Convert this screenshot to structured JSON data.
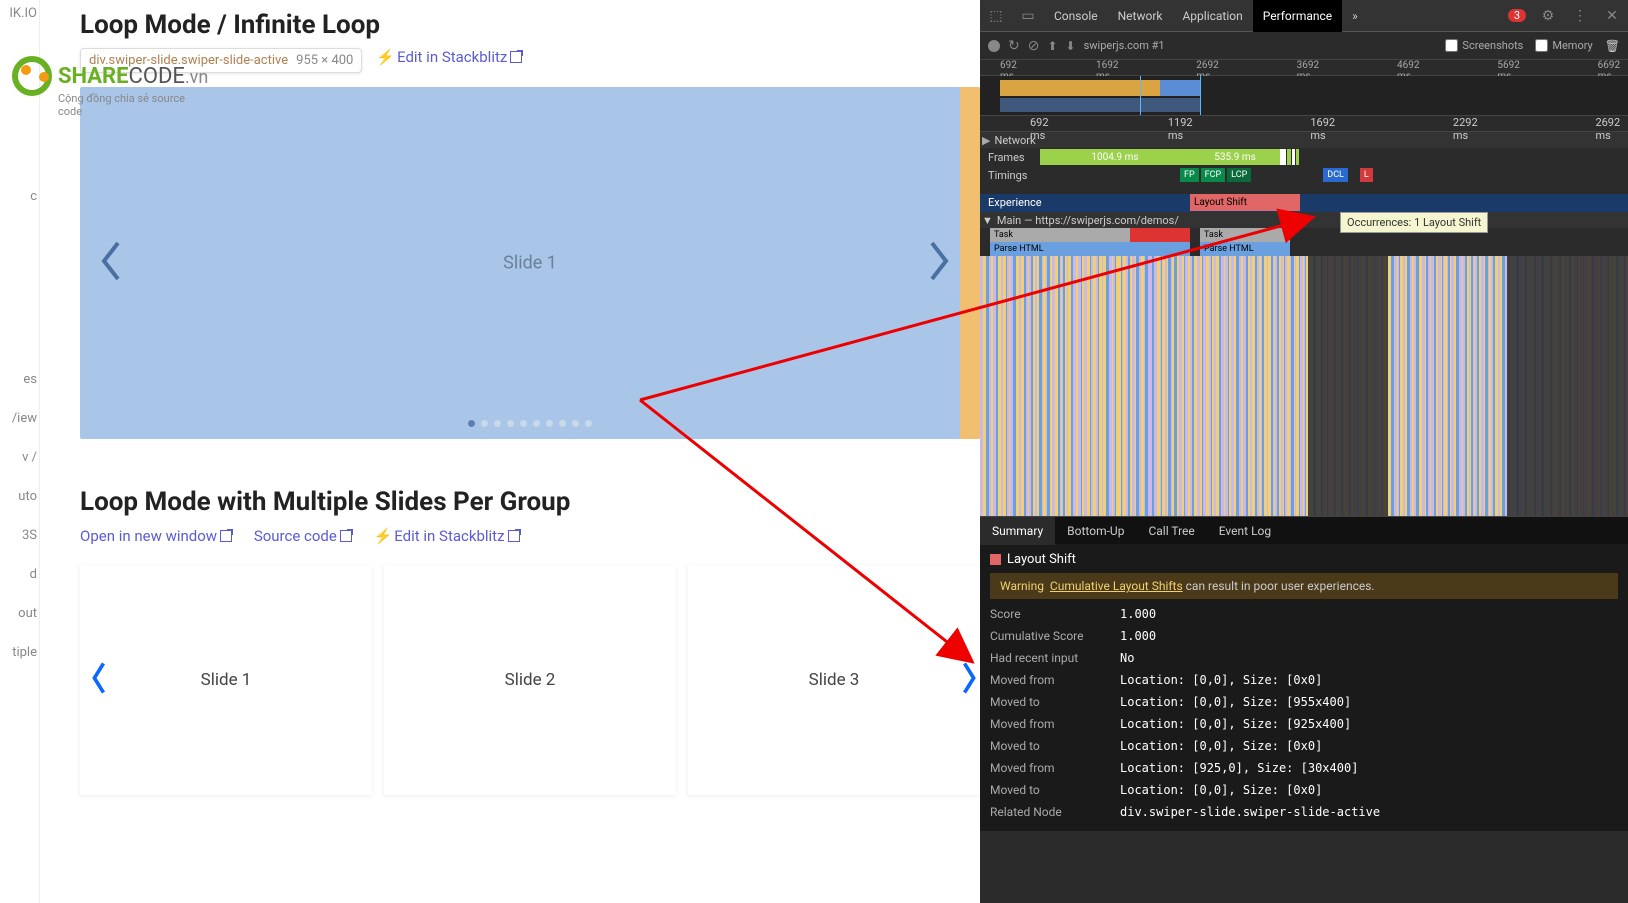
{
  "sidebar": {
    "items": [
      "IK.IO",
      "c",
      "es",
      "/iew",
      "v /",
      "uto",
      "3S",
      "d",
      "out",
      "tiple"
    ]
  },
  "page": {
    "heading1": "Loop Mode / Infinite Loop",
    "inspect_selector": "div.swiper-slide.swiper-slide-active",
    "inspect_dims": "955 × 400",
    "edit_link": "Edit in Stackblitz",
    "swiper1": {
      "slide_label": "Slide 1",
      "dot_count": 10,
      "active_dot": 0
    },
    "heading2": "Loop Mode with Multiple Slides Per Group",
    "links": {
      "open": "Open in new window",
      "source": "Source code",
      "edit": "Edit in Stackblitz"
    },
    "swiper2": {
      "cards": [
        "Slide 1",
        "Slide 2",
        "Slide 3"
      ]
    }
  },
  "logo": {
    "brand1": "SHARE",
    "brand2": "CODE",
    "tld": ".vn",
    "sub": "Cộng đồng chia sẻ source code"
  },
  "devtools": {
    "tabs": [
      "Console",
      "Network",
      "Application",
      "Performance"
    ],
    "active_tab": "Performance",
    "more": "»",
    "error_count": "3",
    "url": "swiperjs.com #1",
    "cb_screenshots": "Screenshots",
    "cb_memory": "Memory",
    "ruler_top": [
      "692 ms",
      "1692 ms",
      "2692 ms",
      "3692 ms",
      "4692 ms",
      "5692 ms",
      "6692 ms"
    ],
    "ruler2": [
      "692 ms",
      "1192 ms",
      "1692 ms",
      "2292 ms",
      "2692 ms"
    ],
    "network_label": "Network",
    "frames": {
      "label": "Frames",
      "seg1": "1004.9 ms",
      "seg2": "535.9 ms"
    },
    "timings": {
      "label": "Timings",
      "badges": [
        "FP",
        "FCP",
        "LCP",
        "DCL",
        "L"
      ]
    },
    "experience": {
      "label": "Experience",
      "shift": "Layout Shift"
    },
    "occurrences_tip": "Occurrences: 1  Layout Shift",
    "main": {
      "label": "Main — https://swiperjs.com/demos/",
      "task": "Task",
      "parse": "Parse HTML"
    },
    "tabs2": [
      "Summary",
      "Bottom-Up",
      "Call Tree",
      "Event Log"
    ],
    "active_tab2": "Summary",
    "summary": {
      "title": "Layout Shift",
      "warning": {
        "label": "Warning",
        "link": "Cumulative Layout Shifts",
        "rest": " can result in poor user experiences."
      },
      "rows": [
        {
          "k": "Score",
          "v": "1.000"
        },
        {
          "k": "Cumulative Score",
          "v": "1.000"
        },
        {
          "k": "Had recent input",
          "v": "No"
        },
        {
          "k": "Moved from",
          "v": "Location: [0,0], Size: [0x0]"
        },
        {
          "k": "Moved to",
          "v": "Location: [0,0], Size: [955x400]"
        },
        {
          "k": "Moved from",
          "v": "Location: [0,0], Size: [925x400]"
        },
        {
          "k": "Moved to",
          "v": "Location: [0,0], Size: [0x0]"
        },
        {
          "k": "Moved from",
          "v": "Location: [925,0], Size: [30x400]"
        },
        {
          "k": "Moved to",
          "v": "Location: [0,0], Size: [0x0]"
        },
        {
          "k": "Related Node",
          "v": "div.swiper-slide.swiper-slide-active"
        }
      ]
    }
  }
}
